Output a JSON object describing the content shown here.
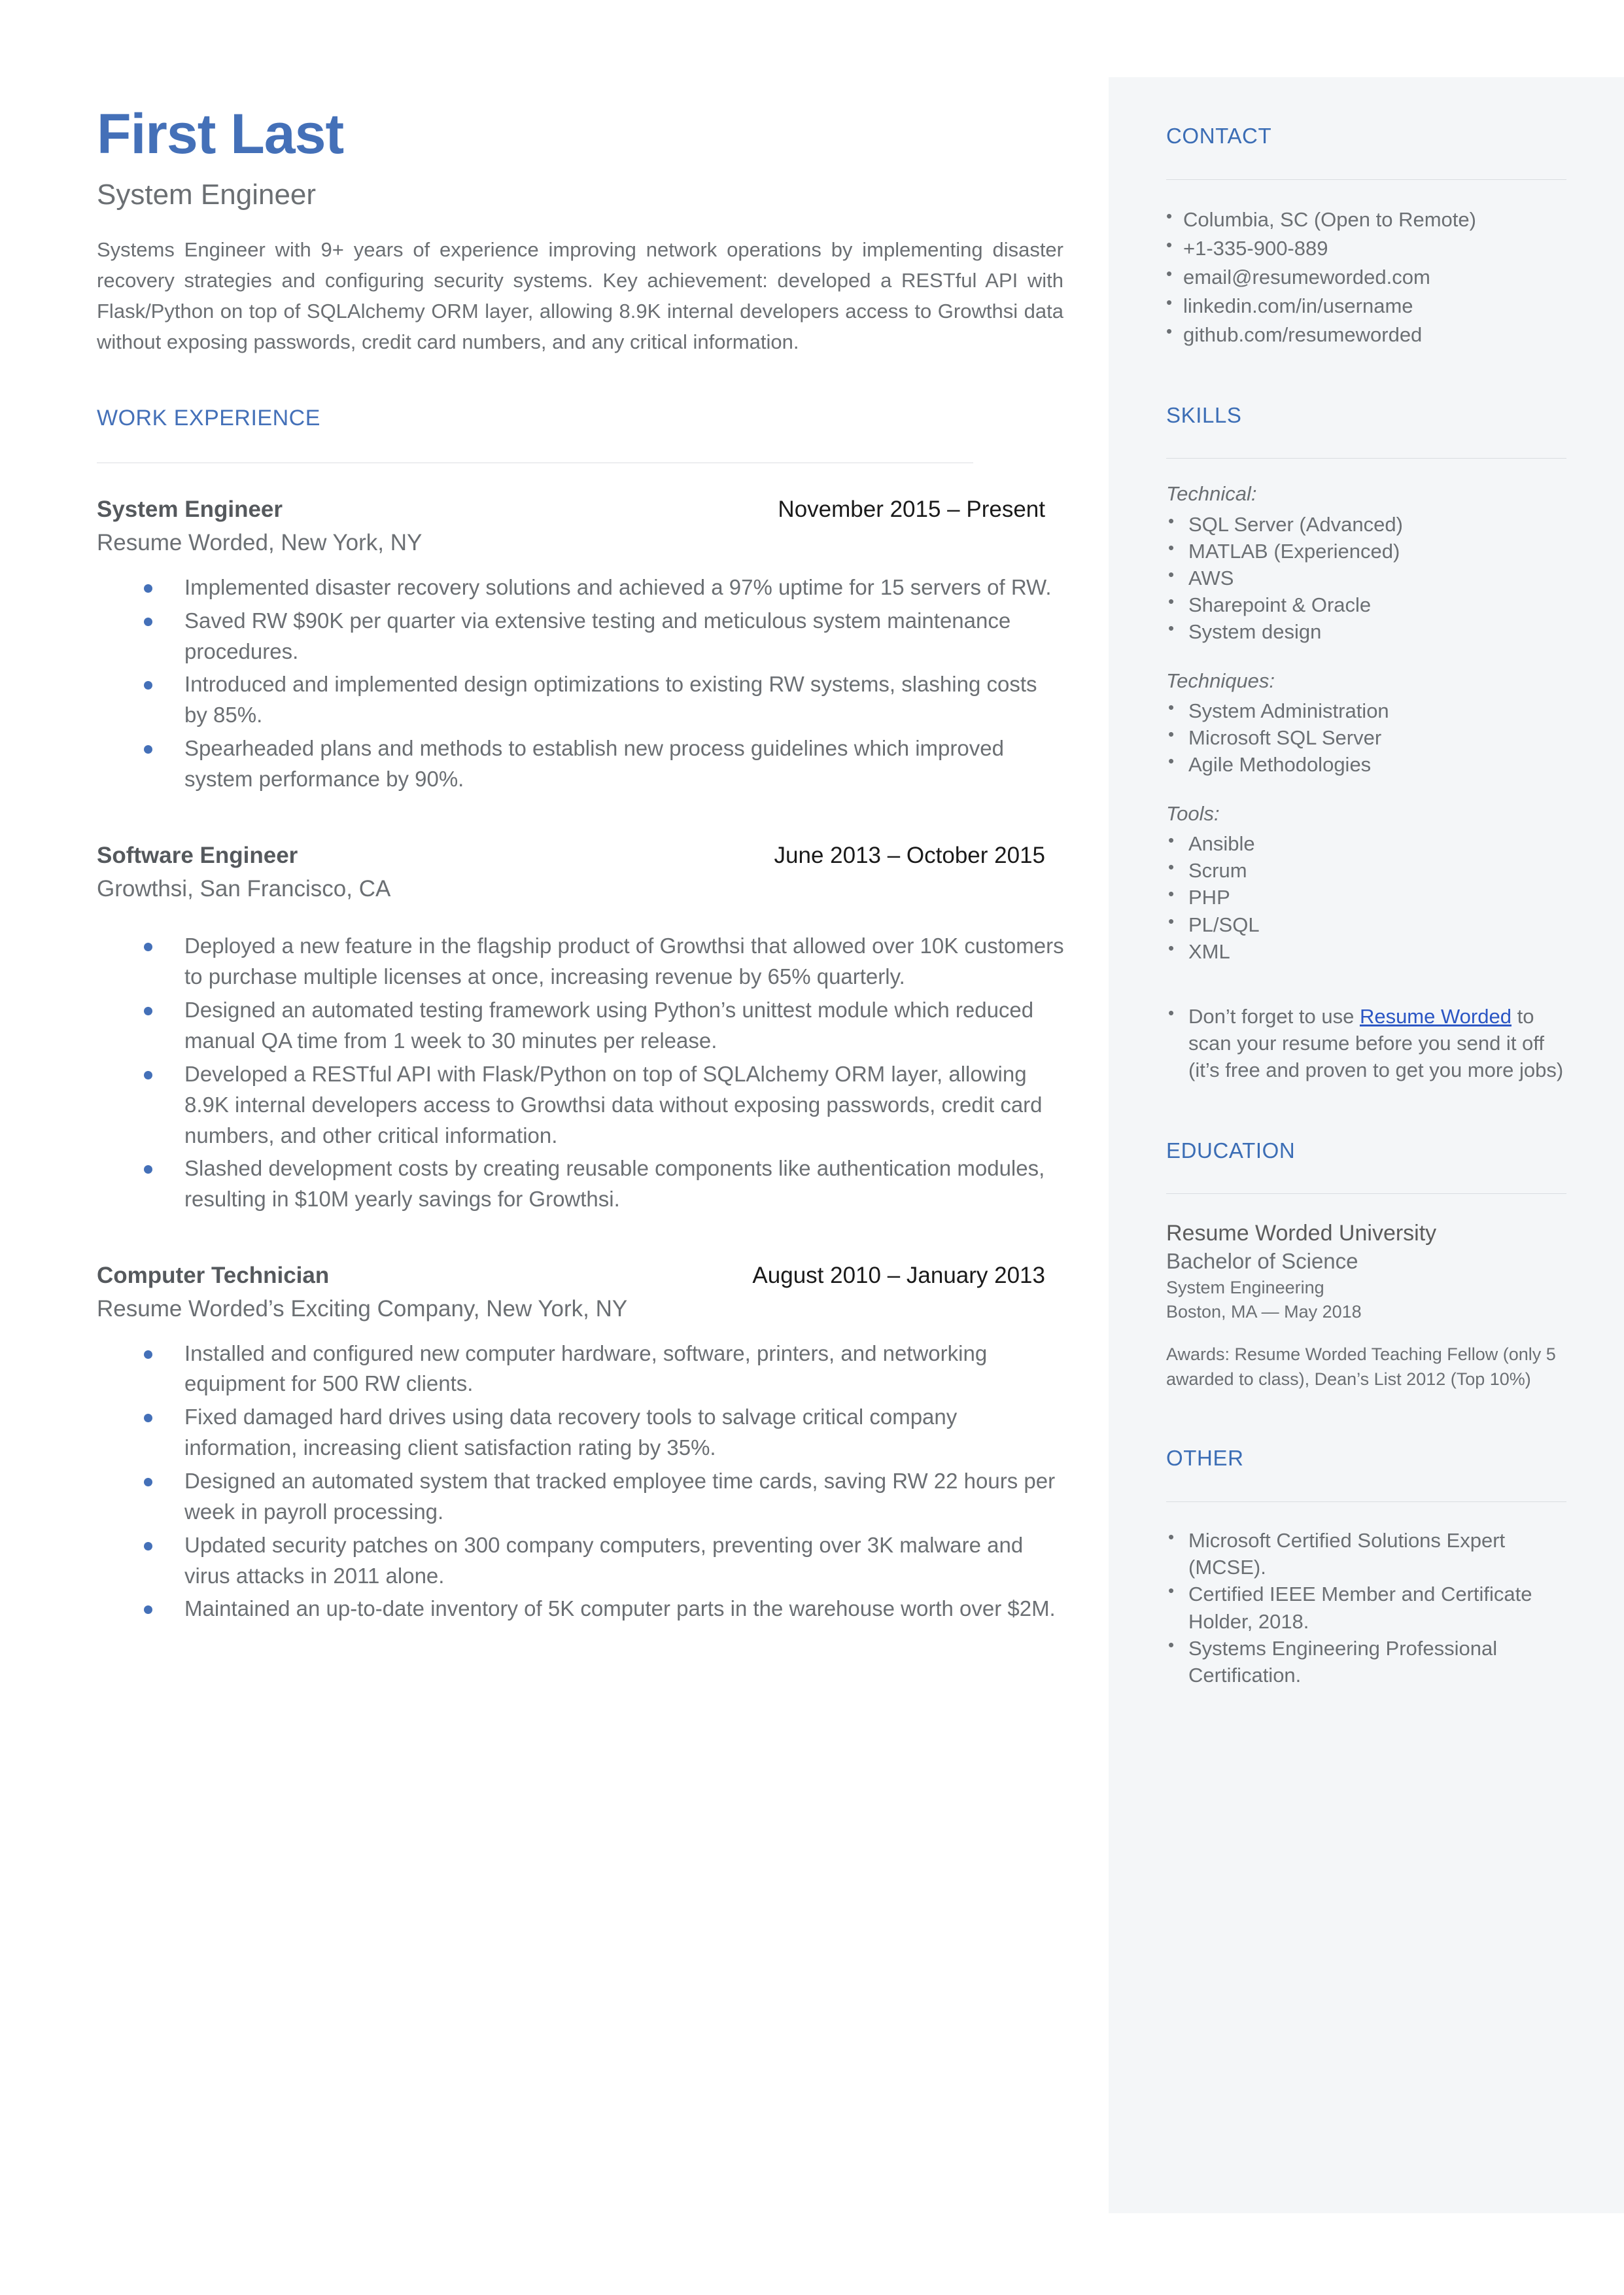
{
  "header": {
    "name": "First Last",
    "title": "System Engineer",
    "summary": "Systems Engineer with 9+ years of experience improving network operations by implementing disaster recovery strategies and configuring security systems. Key achievement: developed a RESTful API with Flask/Python on top of SQLAlchemy ORM layer, allowing 8.9K internal developers access to Growthsi data without exposing passwords, credit card numbers, and any critical information."
  },
  "work": {
    "heading": "WORK EXPERIENCE",
    "jobs": [
      {
        "title": "System Engineer",
        "dates": "November 2015 – Present",
        "company": "Resume Worded, New York, NY",
        "bullets": [
          "Implemented disaster recovery solutions and achieved a 97% uptime for 15 servers of RW.",
          "Saved RW $90K per quarter via extensive testing and meticulous system maintenance procedures.",
          "Introduced and implemented design optimizations to existing RW systems, slashing costs by 85%.",
          "Spearheaded plans and methods to establish new process guidelines which improved system performance by 90%."
        ]
      },
      {
        "title": "Software Engineer",
        "dates": "June 2013 – October 2015",
        "company": "Growthsi, San Francisco, CA",
        "bullets": [
          "Deployed a new feature in the flagship product of Growthsi that allowed over 10K customers to purchase multiple licenses at once, increasing revenue by 65% quarterly.",
          "Designed an automated testing framework using Python’s unittest module which reduced manual QA time from 1 week to 30 minutes per release.",
          "Developed a RESTful API with Flask/Python on top of SQLAlchemy ORM layer, allowing 8.9K internal developers access to Growthsi data without exposing passwords, credit card numbers, and other critical information.",
          "Slashed development costs by creating reusable components like authentication modules, resulting in $10M yearly savings for Growthsi."
        ]
      },
      {
        "title": "Computer Technician",
        "dates": "August 2010 – January 2013",
        "company": "Resume Worded’s Exciting Company, New York, NY",
        "bullets": [
          "Installed and configured new computer hardware, software, printers, and networking equipment for 500 RW clients.",
          "Fixed damaged hard drives using data recovery tools to salvage critical company information, increasing client satisfaction rating by 35%.",
          "Designed an automated system that tracked employee time cards, saving RW 22 hours per week in payroll processing.",
          "Updated security patches on 300 company computers, preventing over 3K malware and virus attacks in 2011 alone.",
          "Maintained an up-to-date inventory of 5K computer parts in the warehouse worth over $2M."
        ]
      }
    ]
  },
  "contact": {
    "heading": "CONTACT",
    "items": [
      "Columbia, SC (Open to Remote)",
      "+1-335-900-889",
      "email@resumeworded.com",
      "linkedin.com/in/username",
      "github.com/resumeworded"
    ]
  },
  "skills": {
    "heading": "SKILLS",
    "groups": [
      {
        "category": "Technical:",
        "items": [
          "SQL Server (Advanced)",
          "MATLAB (Experienced)",
          "AWS",
          "Sharepoint & Oracle",
          "System design"
        ]
      },
      {
        "category": "Techniques:",
        "items": [
          "System Administration",
          "Microsoft SQL Server",
          "Agile Methodologies"
        ]
      },
      {
        "category": "Tools:",
        "items": [
          "Ansible",
          "Scrum",
          "PHP",
          "PL/SQL",
          "XML"
        ]
      }
    ],
    "promo_before": "Don’t forget to use ",
    "promo_link": "Resume Worded",
    "promo_after": " to scan your resume before you send it off (it’s free and proven to get you more jobs)"
  },
  "education": {
    "heading": "EDUCATION",
    "school": "Resume Worded University",
    "degree": "Bachelor of Science",
    "field": "System Engineering",
    "location": "Boston, MA — May 2018",
    "awards": "Awards: Resume Worded Teaching Fellow (only 5 awarded to class), Dean’s List 2012 (Top 10%)"
  },
  "other": {
    "heading": "OTHER",
    "items": [
      "Microsoft Certified Solutions Expert (MCSE).",
      "Certified IEEE Member and Certificate Holder, 2018.",
      "Systems Engineering Professional Certification."
    ]
  },
  "colors": {
    "accent": "#4470b8",
    "sidebar_bg": "#f4f6f8",
    "link": "#2b56c4",
    "body_text": "#6b6f73"
  }
}
